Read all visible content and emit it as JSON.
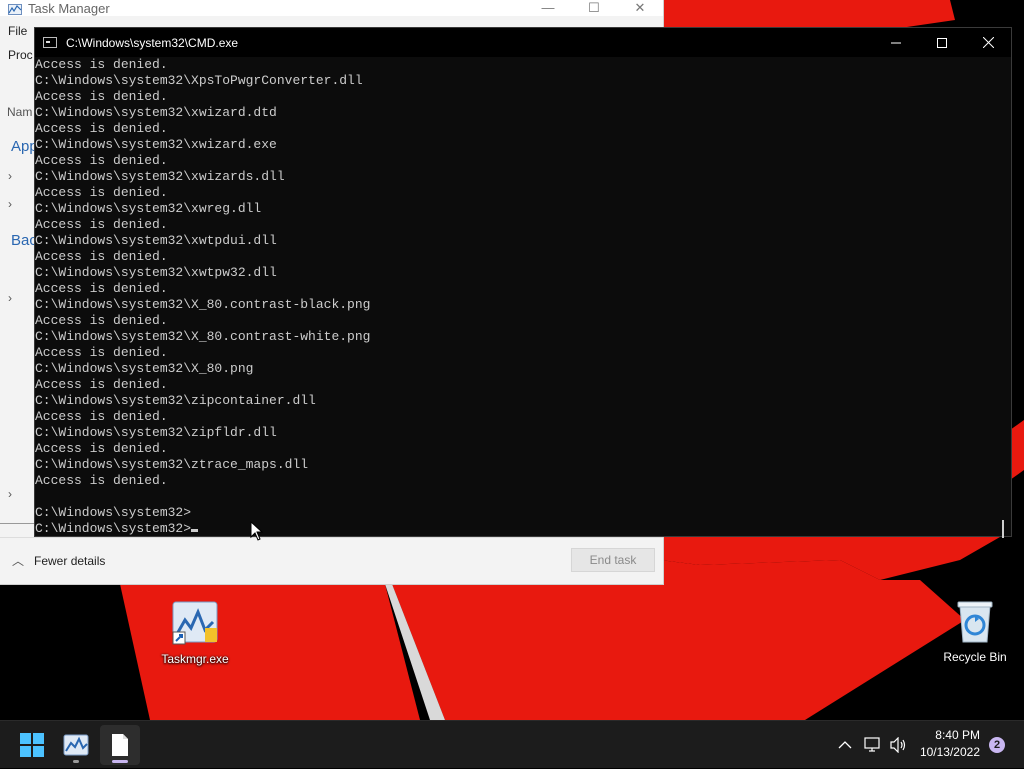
{
  "desktop": {
    "icons": [
      {
        "label": "Taskmgr.exe",
        "icon": "taskmgr-shortcut-icon"
      },
      {
        "label": "Recycle Bin",
        "icon": "recycle-bin-icon"
      }
    ],
    "wallpaper_colors": {
      "ribbon": "#e8190f",
      "background": "#000000"
    }
  },
  "task_manager": {
    "title": "Task Manager",
    "menu_file": "File",
    "tab_processes": "Proc",
    "col_name": "Nam",
    "group_apps": "App",
    "group_background": "Bac",
    "fewer_details": "Fewer details",
    "end_task": "End task"
  },
  "cmd": {
    "title": "C:\\Windows\\system32\\CMD.exe",
    "lines": [
      "Access is denied.",
      "C:\\Windows\\system32\\XpsToPwgrConverter.dll",
      "Access is denied.",
      "C:\\Windows\\system32\\xwizard.dtd",
      "Access is denied.",
      "C:\\Windows\\system32\\xwizard.exe",
      "Access is denied.",
      "C:\\Windows\\system32\\xwizards.dll",
      "Access is denied.",
      "C:\\Windows\\system32\\xwreg.dll",
      "Access is denied.",
      "C:\\Windows\\system32\\xwtpdui.dll",
      "Access is denied.",
      "C:\\Windows\\system32\\xwtpw32.dll",
      "Access is denied.",
      "C:\\Windows\\system32\\X_80.contrast-black.png",
      "Access is denied.",
      "C:\\Windows\\system32\\X_80.contrast-white.png",
      "Access is denied.",
      "C:\\Windows\\system32\\X_80.png",
      "Access is denied.",
      "C:\\Windows\\system32\\zipcontainer.dll",
      "Access is denied.",
      "C:\\Windows\\system32\\zipfldr.dll",
      "Access is denied.",
      "C:\\Windows\\system32\\ztrace_maps.dll",
      "Access is denied.",
      "",
      "C:\\Windows\\system32>"
    ],
    "prompt": "C:\\Windows\\system32>",
    "colors": {
      "background": "#0c0c0c",
      "text": "#cccccc"
    }
  },
  "taskbar": {
    "time": "8:40 PM",
    "date": "10/13/2022",
    "notification_count": "2",
    "apps": [
      {
        "icon": "windows-start-icon"
      },
      {
        "icon": "taskmgr-icon"
      },
      {
        "icon": "cmd-file-icon"
      }
    ],
    "tray_icons": [
      "chevron-up-icon",
      "network-icon",
      "speaker-icon"
    ],
    "accent": "#c8b6f0"
  }
}
